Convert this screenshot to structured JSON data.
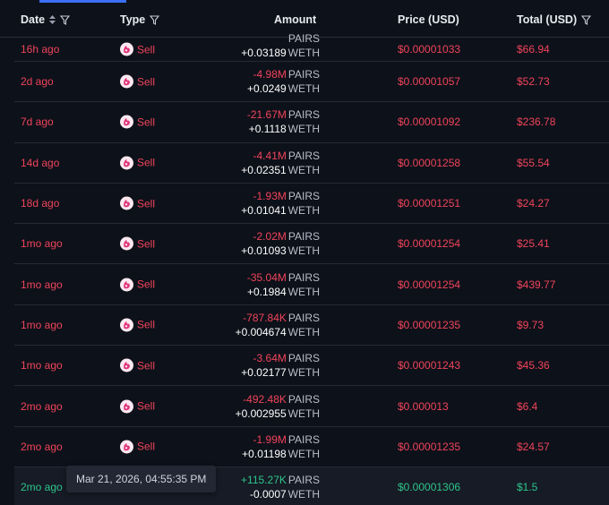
{
  "header": {
    "date": "Date",
    "type": "Type",
    "amount": "Amount",
    "price": "Price (USD)",
    "total": "Total (USD)"
  },
  "colors": {
    "sell": "#f0445a",
    "buy": "#2fc48b",
    "accent": "#3b6ff5"
  },
  "rows": [
    {
      "date": "16h ago",
      "type": "Sell",
      "amount1_value": "",
      "amount1_unit": "PAIRS",
      "amount2_value": "+0.03189",
      "amount2_unit": "WETH",
      "price": "$0.00001033",
      "total": "$66.94"
    },
    {
      "date": "2d ago",
      "type": "Sell",
      "amount1_value": "-4.98M",
      "amount1_unit": "PAIRS",
      "amount2_value": "+0.0249",
      "amount2_unit": "WETH",
      "price": "$0.00001057",
      "total": "$52.73"
    },
    {
      "date": "7d ago",
      "type": "Sell",
      "amount1_value": "-21.67M",
      "amount1_unit": "PAIRS",
      "amount2_value": "+0.1118",
      "amount2_unit": "WETH",
      "price": "$0.00001092",
      "total": "$236.78"
    },
    {
      "date": "14d ago",
      "type": "Sell",
      "amount1_value": "-4.41M",
      "amount1_unit": "PAIRS",
      "amount2_value": "+0.02351",
      "amount2_unit": "WETH",
      "price": "$0.00001258",
      "total": "$55.54"
    },
    {
      "date": "18d ago",
      "type": "Sell",
      "amount1_value": "-1.93M",
      "amount1_unit": "PAIRS",
      "amount2_value": "+0.01041",
      "amount2_unit": "WETH",
      "price": "$0.00001251",
      "total": "$24.27"
    },
    {
      "date": "1mo ago",
      "type": "Sell",
      "amount1_value": "-2.02M",
      "amount1_unit": "PAIRS",
      "amount2_value": "+0.01093",
      "amount2_unit": "WETH",
      "price": "$0.00001254",
      "total": "$25.41"
    },
    {
      "date": "1mo ago",
      "type": "Sell",
      "amount1_value": "-35.04M",
      "amount1_unit": "PAIRS",
      "amount2_value": "+0.1984",
      "amount2_unit": "WETH",
      "price": "$0.00001254",
      "total": "$439.77"
    },
    {
      "date": "1mo ago",
      "type": "Sell",
      "amount1_value": "-787.84K",
      "amount1_unit": "PAIRS",
      "amount2_value": "+0.004674",
      "amount2_unit": "WETH",
      "price": "$0.00001235",
      "total": "$9.73"
    },
    {
      "date": "1mo ago",
      "type": "Sell",
      "amount1_value": "-3.64M",
      "amount1_unit": "PAIRS",
      "amount2_value": "+0.02177",
      "amount2_unit": "WETH",
      "price": "$0.00001243",
      "total": "$45.36"
    },
    {
      "date": "2mo ago",
      "type": "Sell",
      "amount1_value": "-492.48K",
      "amount1_unit": "PAIRS",
      "amount2_value": "+0.002955",
      "amount2_unit": "WETH",
      "price": "$0.000013",
      "total": "$6.4"
    },
    {
      "date": "2mo ago",
      "type": "Sell",
      "amount1_value": "-1.99M",
      "amount1_unit": "PAIRS",
      "amount2_value": "+0.01198",
      "amount2_unit": "WETH",
      "price": "$0.00001235",
      "total": "$24.57"
    },
    {
      "date": "2mo ago",
      "type": "",
      "amount1_value": "+115.27K",
      "amount1_unit": "PAIRS",
      "amount2_value": "-0.0007",
      "amount2_unit": "WETH",
      "price": "$0.00001306",
      "total": "$1.5",
      "side": "buy"
    }
  ],
  "tooltip": "Mar 21, 2026, 04:55:35 PM"
}
